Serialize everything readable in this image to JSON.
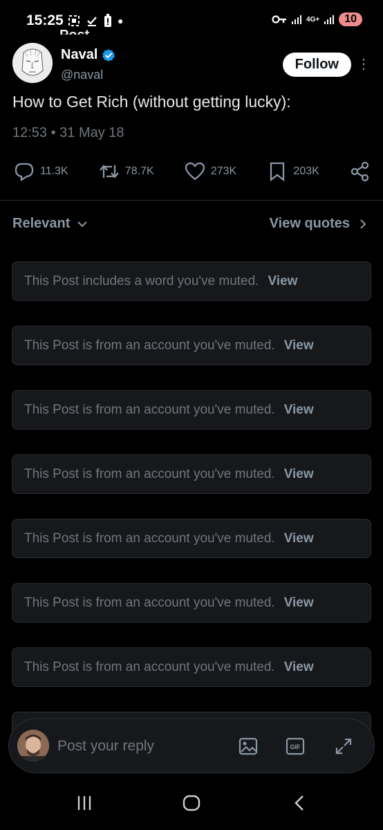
{
  "status_bar": {
    "time": "15:25",
    "notification_count": "10",
    "network_label": "4G+"
  },
  "peek_header": "Post",
  "author": {
    "name": "Naval",
    "handle": "@naval",
    "verified": true,
    "follow_label": "Follow"
  },
  "post": {
    "text": "How to Get Rich (without getting lucky):",
    "timestamp": "12:53 • 31 May 18"
  },
  "actions": {
    "replies": "11.3K",
    "reposts": "78.7K",
    "likes": "273K",
    "bookmarks": "203K"
  },
  "sort": {
    "relevant_label": "Relevant",
    "view_quotes_label": "View quotes"
  },
  "muted_posts": [
    {
      "text": "This Post includes a word you've muted.",
      "view": "View"
    },
    {
      "text": "This Post is from an account you've muted.",
      "view": "View"
    },
    {
      "text": "This Post is from an account you've muted.",
      "view": "View"
    },
    {
      "text": "This Post is from an account you've muted.",
      "view": "View"
    },
    {
      "text": "This Post is from an account you've muted.",
      "view": "View"
    },
    {
      "text": "This Post is from an account you've muted.",
      "view": "View"
    },
    {
      "text": "This Post is from an account you've muted.",
      "view": "View"
    }
  ],
  "reply": {
    "placeholder": "Post your reply"
  },
  "colors": {
    "background": "#000000",
    "verified_blue": "#1d9bf0",
    "muted_text": "#71767b"
  }
}
